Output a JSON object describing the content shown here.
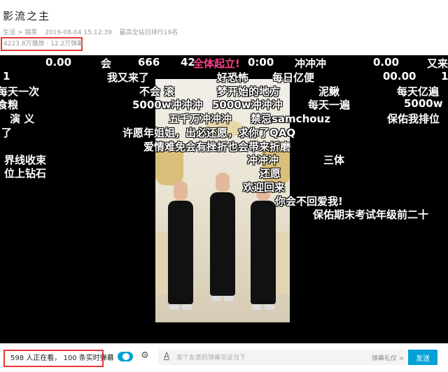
{
  "header": {
    "title": "影流之主",
    "category": "生活",
    "separator": ">",
    "subcategory": "搞笑",
    "datetime": "2019-08-04 15:12:39",
    "rank": "最高全站日排行19名"
  },
  "stats": {
    "views": "4223.8万播放",
    "dot": "·",
    "danmaku": "12.2万弹幕"
  },
  "danmaku": [
    {
      "text": "0.00",
      "color": "#ffffff"
    },
    {
      "text": "会",
      "color": "#ffffff"
    },
    {
      "text": "666",
      "color": "#ffffff"
    },
    {
      "text": "42",
      "color": "#ffffff"
    },
    {
      "text": "全体起立!",
      "color": "#ff3f8a"
    },
    {
      "text": "0:00",
      "color": "#ffffff"
    },
    {
      "text": "冲冲冲",
      "color": "#ffffff"
    },
    {
      "text": "0.00",
      "color": "#ffffff"
    },
    {
      "text": "又来",
      "color": "#ffffff"
    },
    {
      "text": "1",
      "color": "#ffffff"
    },
    {
      "text": "我又来了",
      "color": "#ffffff"
    },
    {
      "text": "好恐怖",
      "color": "#ffffff"
    },
    {
      "text": "每日亿便",
      "color": "#ffffff"
    },
    {
      "text": "00.00",
      "color": "#ffffff"
    },
    {
      "text": "1",
      "color": "#ffffff"
    },
    {
      "text": "每天一次",
      "color": "#ffffff"
    },
    {
      "text": "不会 滚",
      "color": "#ffffff"
    },
    {
      "text": "梦开始的地方",
      "color": "#ffffff"
    },
    {
      "text": "泥鳅",
      "color": "#ffffff"
    },
    {
      "text": "每天亿遍",
      "color": "#ffffff"
    },
    {
      "text": "食粮",
      "color": "#ffffff"
    },
    {
      "text": "5000w冲冲冲",
      "color": "#ffffff"
    },
    {
      "text": "5000w冲冲冲",
      "color": "#ffffff"
    },
    {
      "text": "每天一遍",
      "color": "#ffffff"
    },
    {
      "text": "5000w",
      "color": "#ffffff"
    },
    {
      "text": "演 义",
      "color": "#ffffff"
    },
    {
      "text": "五千万冲冲冲",
      "color": "#ffffff"
    },
    {
      "text": "禁忌samchouz",
      "color": "#ffffff"
    },
    {
      "text": "保佑我排位",
      "color": "#ffffff"
    },
    {
      "text": "了",
      "color": "#ffffff"
    },
    {
      "text": "许愿年姐姐，出必还愿，求你了QAQ",
      "color": "#ffffff"
    },
    {
      "text": "爱情难免会有挫折也会带来折磨",
      "color": "#ffffff"
    },
    {
      "text": "界线收束",
      "color": "#ffffff"
    },
    {
      "text": "冲冲冲",
      "color": "#ffffff"
    },
    {
      "text": "三体",
      "color": "#ffffff"
    },
    {
      "text": "位上钻石",
      "color": "#ffffff"
    },
    {
      "text": "还愿",
      "color": "#ffffff"
    },
    {
      "text": "欢迎回来",
      "color": "#ffffff"
    },
    {
      "text": "你会不回爱我!",
      "color": "#ffffff"
    },
    {
      "text": "保佑期末考试年级前二十",
      "color": "#ffffff"
    }
  ],
  "footer": {
    "viewers_count": "598",
    "viewers_text": "人正在看，",
    "live_count": "100",
    "live_text": "条实时弹幕",
    "input_placeholder": "发个友善的弹幕见证当下",
    "etiquette": "弹幕礼仪 >",
    "send": "发送"
  },
  "colors": {
    "accent": "#00a1d6",
    "highlight_box": "#e53935"
  }
}
